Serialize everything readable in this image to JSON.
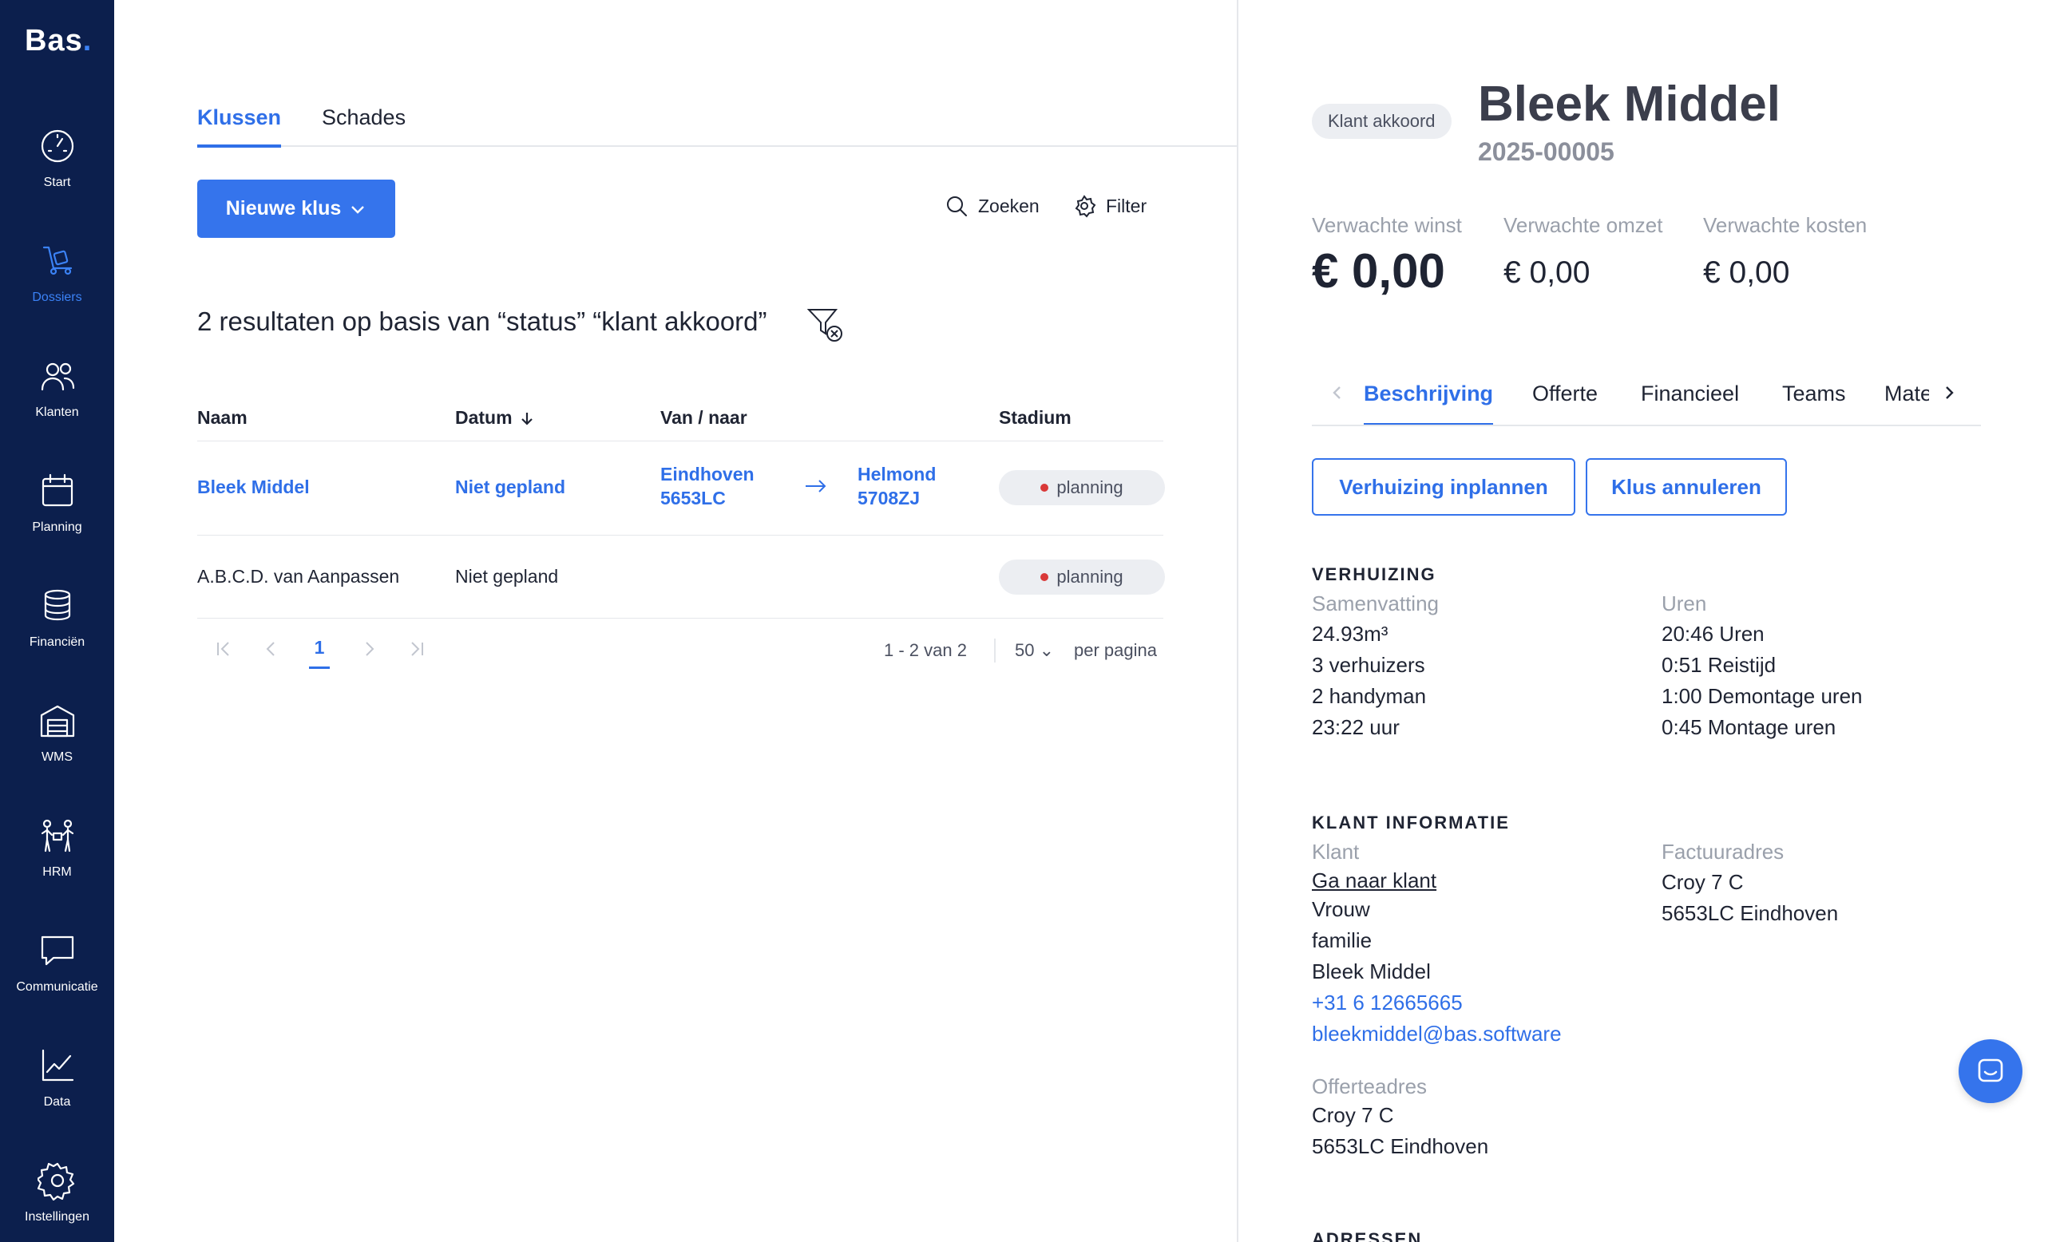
{
  "sidebar": {
    "logo": "Bas",
    "logo_dot": ".",
    "items": [
      {
        "label": "Start",
        "icon": "gauge-icon"
      },
      {
        "label": "Dossiers",
        "icon": "dolly-icon",
        "active": true
      },
      {
        "label": "Klanten",
        "icon": "users-icon"
      },
      {
        "label": "Planning",
        "icon": "calendar-icon"
      },
      {
        "label": "Financiën",
        "icon": "coins-icon"
      },
      {
        "label": "WMS",
        "icon": "warehouse-icon"
      },
      {
        "label": "HRM",
        "icon": "people-icon"
      },
      {
        "label": "Communicatie",
        "icon": "chat-icon"
      },
      {
        "label": "Data",
        "icon": "chart-icon"
      },
      {
        "label": "Instellingen",
        "icon": "gear-icon"
      }
    ]
  },
  "main": {
    "tabs": [
      {
        "label": "Klussen",
        "active": true
      },
      {
        "label": "Schades"
      }
    ],
    "new_button": "Nieuwe klus",
    "search_label": "Zoeken",
    "filter_label": "Filter",
    "results_text": "2 resultaten op basis van “status” “klant akkoord”",
    "table": {
      "headers": [
        "Naam",
        "Datum",
        "Van / naar",
        "Stadium"
      ],
      "rows": [
        {
          "name": "Bleek Middel",
          "date": "Niet gepland",
          "from_city": "Eindhoven",
          "from_zip": "5653LC",
          "to_city": "Helmond",
          "to_zip": "5708ZJ",
          "stage": "planning"
        },
        {
          "name": "A.B.C.D. van Aanpassen",
          "date": "Niet gepland",
          "stage": "planning"
        }
      ]
    },
    "pagination": {
      "current_page": "1",
      "range": "1 - 2 van 2",
      "per_page_value": "50",
      "per_page_label": "per pagina"
    }
  },
  "detail": {
    "status": "Klant akkoord",
    "title": "Bleek Middel",
    "number": "2025-00005",
    "kpis": [
      {
        "label": "Verwachte winst",
        "value": "€ 0,00"
      },
      {
        "label": "Verwachte omzet",
        "value": "€ 0,00"
      },
      {
        "label": "Verwachte kosten",
        "value": "€ 0,00"
      }
    ],
    "tabs": [
      "Beschrijving",
      "Offerte",
      "Financieel",
      "Teams",
      "Materiaal"
    ],
    "buttons": {
      "schedule": "Verhuizing inplannen",
      "cancel": "Klus annuleren"
    },
    "verhuizing": {
      "heading": "VERHUIZING",
      "summary_label": "Samenvatting",
      "summary": [
        "24.93m³",
        "3 verhuizers",
        "2 handyman",
        "23:22 uur"
      ],
      "hours_label": "Uren",
      "hours": [
        "20:46 Uren",
        "0:51 Reistijd",
        "1:00 Demontage uren",
        "0:45 Montage uren"
      ]
    },
    "klant": {
      "heading": "KLANT INFORMATIE",
      "client_label": "Klant",
      "goto_link": "Ga naar klant",
      "gender": "Vrouw",
      "type": "familie",
      "name": "Bleek Middel",
      "phone": "+31 6 12665665",
      "email": "bleekmiddel@bas.software",
      "invoice_label": "Factuuradres",
      "invoice_lines": [
        "Croy 7 C",
        "5653LC Eindhoven"
      ],
      "quote_label": "Offerteadres",
      "quote_lines": [
        "Croy 7 C",
        "5653LC Eindhoven"
      ]
    },
    "next_heading": "ADRESSEN"
  },
  "colors": {
    "sidebar": "#0c1f4d",
    "accent": "#3574ec",
    "status_dot": "#d93838"
  }
}
